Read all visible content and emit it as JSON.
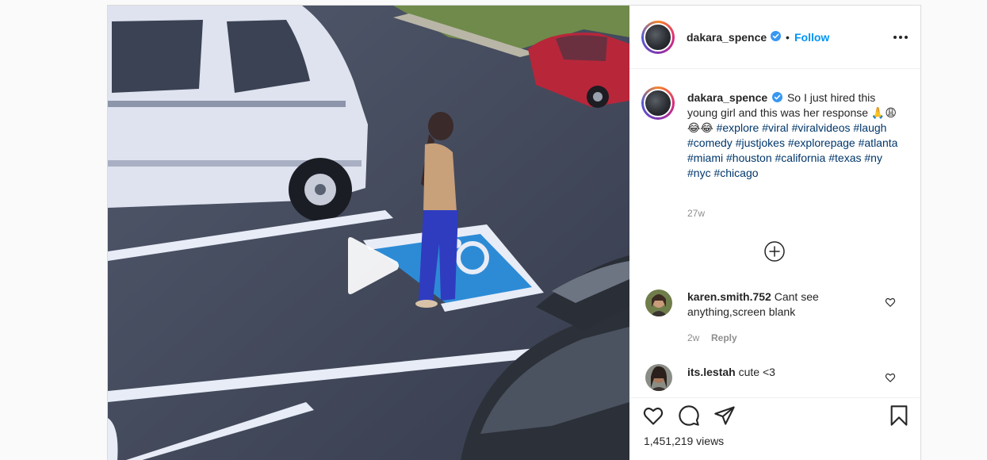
{
  "post": {
    "username": "dakara_spence",
    "separator": "•",
    "follow_label": "Follow",
    "caption_text": "So I just hired this young girl and this was her response 🙏😩😂😂",
    "hashtags": [
      "#explore",
      "#viral",
      "#viralvideos",
      "#laugh",
      "#comedy",
      "#justjokes",
      "#explorepage",
      "#atlanta",
      "#miami",
      "#houston",
      "#california",
      "#texas",
      "#ny",
      "#nyc",
      "#chicago"
    ],
    "caption_age": "27w",
    "views": "1,451,219 views"
  },
  "comments": [
    {
      "username": "karen.smith.752",
      "text": "Cant see anything,screen blank",
      "age": "2w",
      "reply_label": "Reply"
    },
    {
      "username": "its.lestah",
      "text": "cute <3"
    }
  ],
  "icons": {
    "verified": "verified-badge-icon",
    "more": "more-options-icon",
    "add": "add-circle-icon",
    "like": "heart-icon",
    "comment": "comment-icon",
    "share": "share-icon",
    "save": "bookmark-icon",
    "play": "play-icon"
  },
  "colors": {
    "link_blue": "#0095f6",
    "hashtag": "#00376b",
    "muted": "#8e8e8e",
    "border": "#dbdbdb"
  }
}
